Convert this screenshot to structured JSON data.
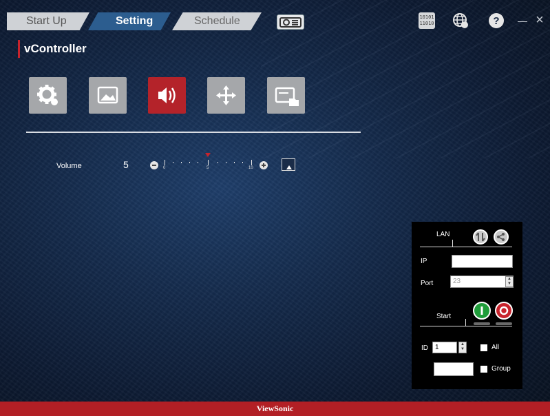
{
  "tabs": [
    {
      "label": "Start Up"
    },
    {
      "label": "Setting"
    },
    {
      "label": "Schedule"
    }
  ],
  "header_icons": [
    "projector-icon",
    "binary-icon",
    "globe-icon",
    "help-icon",
    "minimize-icon",
    "close-icon"
  ],
  "page": {
    "title": "vController"
  },
  "setting_buttons": [
    {
      "name": "general-settings",
      "icon": "gear-icon"
    },
    {
      "name": "image",
      "icon": "image-icon"
    },
    {
      "name": "audio",
      "icon": "speaker-icon",
      "active": true
    },
    {
      "name": "position",
      "icon": "move-arrows-icon"
    },
    {
      "name": "display",
      "icon": "screen-folder-icon"
    }
  ],
  "volume": {
    "label": "Volume",
    "value": "5",
    "min_label": "0",
    "mid_label": "5",
    "max_label": "10",
    "level": 5,
    "max": 10
  },
  "connection": {
    "lan_label": "LAN",
    "ip_label": "IP",
    "ip_value": "",
    "port_label": "Port",
    "port_value": "23",
    "start_label": "Start",
    "id_label": "ID",
    "id_value": "1",
    "all_label": "All",
    "group_label": "Group",
    "group_value": ""
  },
  "footer": {
    "brand": "ViewSonic"
  },
  "colors": {
    "accent": "#c8232c",
    "active_tab": "#2c5d8f",
    "footer": "#b21f25",
    "start_green": "#1f9d3a"
  }
}
